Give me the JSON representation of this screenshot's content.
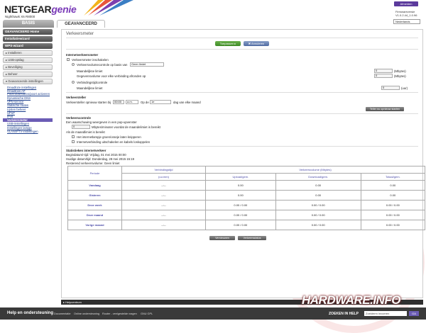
{
  "header": {
    "brand": "NETGEAR",
    "genie": "genie",
    "model": "Nighthawk X6 R8000",
    "logout": "Afmelden",
    "fw_label": "Firmwareversie",
    "fw_version": "V1.0.2.44_1.0.96",
    "language": "Nederlands"
  },
  "tabs": {
    "basic": "BASIS",
    "advanced": "GEAVANCEERD"
  },
  "sidebar": {
    "home": "GEAVANCEERD Home",
    "setup_wizard": "Installatiewizard",
    "wps": "WPS-wizard",
    "groups": [
      "▸ Installeren",
      "▸ USB-opslag",
      "▸ Beveiliging",
      "▸ Beheer",
      "▾ Geavanceerde instellingen"
    ],
    "links": [
      "Draadloze instellingen",
      "Draadloos AP",
      "Poort doorsturen/poort activeren",
      "Dynamische DNS",
      "VPN-service",
      "Statische routes",
      "Lijsten beheer",
      "UPnP",
      "IPv6",
      "Verkeersmeter",
      "USB-instellingen",
      "Instellingen lampje",
      "VLAN/IPTV-instellingen"
    ]
  },
  "main": {
    "title": "Verkeersmeter",
    "apply": "Toepassen ▸",
    "cancel": "✖ Annuleren",
    "section1": "Internetverkeersmeter",
    "enable_meter": "Verkeersmeter inschakelen",
    "volume_label": "Verkeersvolumecontrole op basis van",
    "volume_select": "Geen limiet",
    "monthly_limit": "Maandelijkse limiet",
    "round_up": "Gegevensvolume voor elke verbinding afronden op",
    "mbytes": "(Mbytes)",
    "conn_time": "Verbindingstijdcontrole",
    "monthly_limit2": "Maandelijkse limiet",
    "hours": "(uur)",
    "monthly_val": "0",
    "round_val": "0",
    "hours_val": "0",
    "section2": "Verkeersteller",
    "counter_restart": "Verkeersteller opnieuw starten bij",
    "time_val": "00:00",
    "ampm": "a.m.",
    "on_day": "Op de",
    "day": "1e",
    "day_suffix": "dag van elke maand",
    "restart_now": "Teller nu opnieuw starten",
    "section3": "Verkeerscontrole",
    "popup_msg": "Een waarschuwing weergeven in een pop-upvenster",
    "min_before": "Mbytes/minuten voordat de maandelimiet is bereikt",
    "min_val": "0",
    "when_limit": "Als de maandlimiet is bereikt",
    "led_blink": "Het internetlampje groen/oranje laten knipperen",
    "disconnect": "Internetverbinding uitschakelen en kabels loskoppelen",
    "stats_title": "Statistieken internetverkeer",
    "start_date": "Begindatum/-tijd: Vrijdag, 01 mei 2015 00:00",
    "current_date": "Huidige datum/tijd: Donderdag, 28 mei 2015 15:19",
    "remaining": "Resterend verkeersvolume: Geen limiet",
    "col_period": "Periode",
    "col_conntime": "Verbindingstijd",
    "col_conntime_unit": "(uu:mm)",
    "col_volume": "Verkeersvolume (Mbytes)",
    "col_upload": "Upload/gem.",
    "col_download": "Download/gem.",
    "col_total": "Totaal/gem.",
    "rows": [
      {
        "label": "Vandaag",
        "time": "--:--",
        "up": "0.00",
        "down": "0.00",
        "total": "0.00"
      },
      {
        "label": "Gisteren",
        "time": "--:--",
        "up": "0.00",
        "down": "0.00",
        "total": "0.00"
      },
      {
        "label": "Deze week",
        "time": "--:--",
        "up": "0.00 / 0.00",
        "down": "0.00 / 0.00",
        "total": "0.00 / 0.00"
      },
      {
        "label": "Deze maand",
        "time": "--:--",
        "up": "0.00 / 0.00",
        "down": "0.00 / 0.00",
        "total": "0.00 / 0.00"
      },
      {
        "label": "Vorige maand",
        "time": "--:--",
        "up": "0.00 / 0.00",
        "down": "0.00 / 0.00",
        "total": "0.00 / 0.00"
      }
    ],
    "refresh": "Vernieuwen",
    "traffic_status": "Verkeersstatus"
  },
  "help_bar": "▸ Helpcentrum",
  "footer": {
    "title": "Help en ondersteuning",
    "links": [
      "Documentatie",
      "Online ondersteuning",
      "Router - veelgestelde vragen",
      "GNU GPL"
    ],
    "search_label": "ZOEKEN IN HELP",
    "search_placeholder": "Zoekterm invoeren",
    "go": "GA"
  },
  "watermark": "HARDWARE.INFO"
}
